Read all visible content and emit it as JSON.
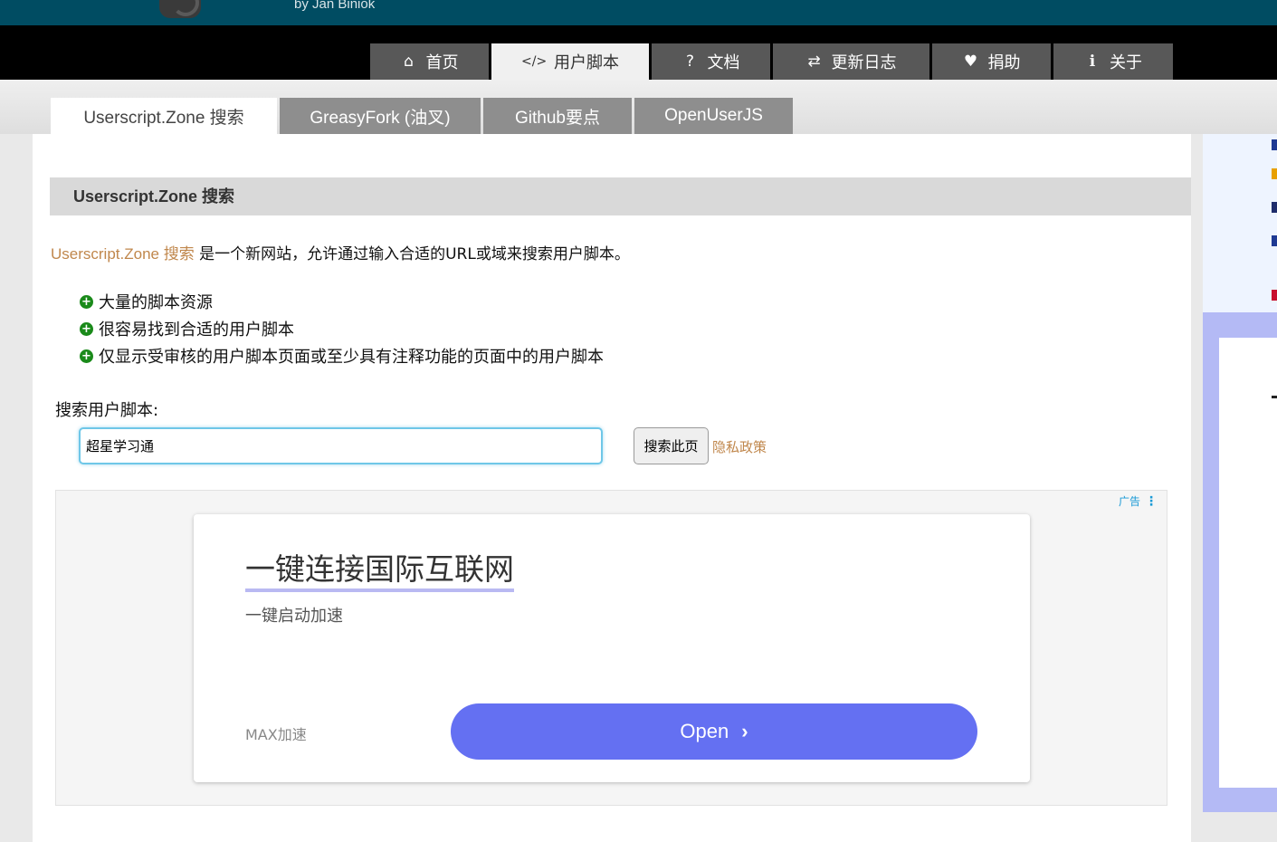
{
  "header": {
    "byline": "by Jan Biniok"
  },
  "nav": {
    "items": [
      {
        "icon": "home-icon",
        "glyph": "⌂",
        "label": "首页"
      },
      {
        "icon": "code-icon",
        "glyph": "</>",
        "label": "用户脚本"
      },
      {
        "icon": "question-icon",
        "glyph": "?",
        "label": "文档"
      },
      {
        "icon": "exchange-icon",
        "glyph": "⇄",
        "label": "更新日志"
      },
      {
        "icon": "heart-icon",
        "glyph": "♥",
        "label": "捐助"
      },
      {
        "icon": "info-icon",
        "glyph": "ℹ",
        "label": "关于"
      }
    ],
    "active": 1
  },
  "subtabs": {
    "items": [
      "Userscript.Zone 搜索",
      "GreasyFork (油叉)",
      "Github要点",
      "OpenUserJS"
    ],
    "active": 0
  },
  "section": {
    "title": "Userscript.Zone 搜索",
    "intro_link": "Userscript.Zone 搜索",
    "intro_text": " 是一个新网站，允许通过输入合适的URL或域来搜索用户脚本。",
    "features": [
      "大量的脚本资源",
      "很容易找到合适的用户脚本",
      "仅显示受审核的用户脚本页面或至少具有注释功能的页面中的用户脚本"
    ]
  },
  "search": {
    "label": "搜索用户脚本:",
    "value": "超星学习通",
    "button": "搜索此页",
    "privacy": "隐私政策"
  },
  "ad": {
    "label": "广告",
    "title": "一键连接国际互联网",
    "subtitle": "一键启动加速",
    "brand": "MAX加速",
    "cta": "Open",
    "cta_color": "#6470f2"
  },
  "colors": {
    "banner": "#004c62",
    "link": "#c0874c",
    "feature_icon": "#1a8a1a"
  }
}
